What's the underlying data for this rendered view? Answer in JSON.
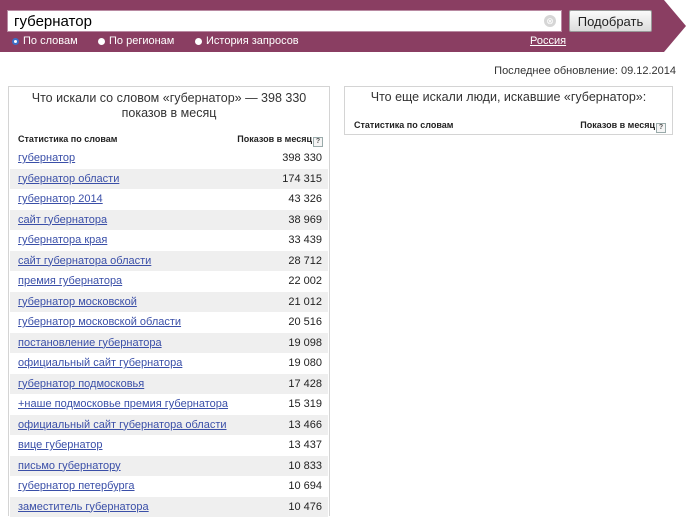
{
  "search": {
    "value": "губернатор",
    "clear_glyph": "⊗",
    "button_label": "Подобрать"
  },
  "modes": [
    {
      "label": "По словам",
      "checked": true
    },
    {
      "label": "По регионам",
      "checked": false
    },
    {
      "label": "История запросов",
      "checked": false
    }
  ],
  "region": "Россия",
  "last_update": "Последнее обновление: 09.12.2014",
  "left_panel": {
    "title": "Что искали со словом «губернатор» — 398 330 показов в месяц",
    "col_phrase": "Статистика по словам",
    "col_count": "Показов в месяц",
    "help_glyph": "?",
    "rows": [
      {
        "phrase": "губернатор",
        "count": "398 330"
      },
      {
        "phrase": "губернатор области",
        "count": "174 315"
      },
      {
        "phrase": "губернатор 2014",
        "count": "43 326"
      },
      {
        "phrase": "сайт губернатора",
        "count": "38 969"
      },
      {
        "phrase": "губернатора края",
        "count": "33 439"
      },
      {
        "phrase": "сайт губернатора области",
        "count": "28 712"
      },
      {
        "phrase": "премия губернатора",
        "count": "22 002"
      },
      {
        "phrase": "губернатор московской",
        "count": "21 012"
      },
      {
        "phrase": "губернатор московской области",
        "count": "20 516"
      },
      {
        "phrase": "постановление губернатора",
        "count": "19 098"
      },
      {
        "phrase": "официальный сайт губернатора",
        "count": "19 080"
      },
      {
        "phrase": "губернатор подмосковья",
        "count": "17 428"
      },
      {
        "phrase": "+наше подмосковье премия губернатора",
        "count": "15 319"
      },
      {
        "phrase": "официальный сайт губернатора области",
        "count": "13 466"
      },
      {
        "phrase": "вице губернатор",
        "count": "13 437"
      },
      {
        "phrase": "письмо губернатору",
        "count": "10 833"
      },
      {
        "phrase": "губернатор петербурга",
        "count": "10 694"
      },
      {
        "phrase": "заместитель губернатора",
        "count": "10 476"
      }
    ]
  },
  "right_panel": {
    "title": "Что еще искали люди, искавшие «губернатор»:",
    "col_phrase": "Статистика по словам",
    "col_count": "Показов в месяц",
    "help_glyph": "?"
  }
}
